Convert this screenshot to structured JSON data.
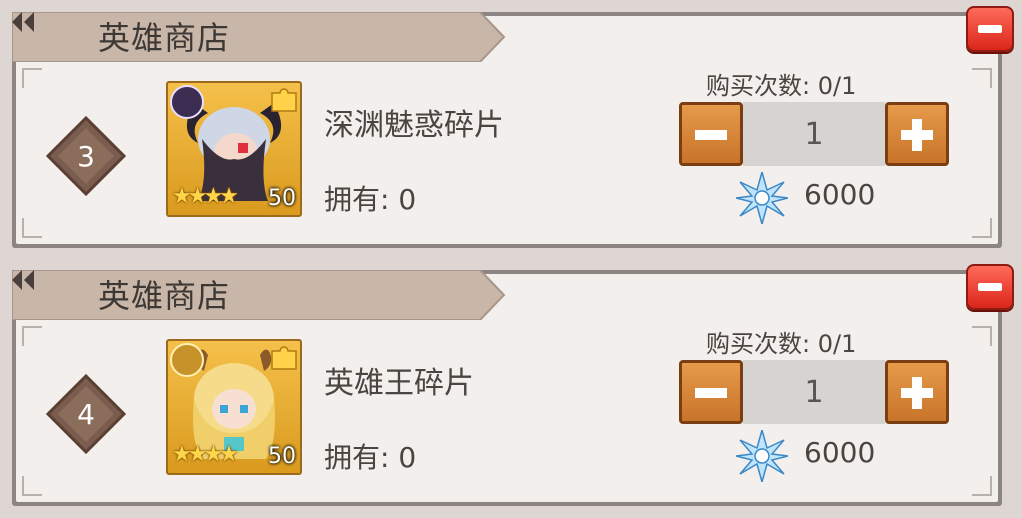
{
  "offers": [
    {
      "header_title": "英雄商店",
      "rank": "3",
      "item_name": "深渊魅惑碎片",
      "owned_label": "拥有: 0",
      "purchase_limit_label": "购买次数: 0/1",
      "quantity": "1",
      "cost": "6000",
      "item_level": "50",
      "stars": "★★★★",
      "portrait_icon": "demon-girl-portrait",
      "badge_icon": "eye-emblem-icon"
    },
    {
      "header_title": "英雄商店",
      "rank": "4",
      "item_name": "英雄王碎片",
      "owned_label": "拥有: 0",
      "purchase_limit_label": "购买次数: 0/1",
      "quantity": "1",
      "cost": "6000",
      "item_level": "50",
      "stars": "★★★★",
      "portrait_icon": "blonde-girl-portrait",
      "badge_icon": "wing-emblem-icon"
    }
  ],
  "colors": {
    "accent_orange": "#d9822f",
    "close_red": "#e0392a",
    "header_bg": "#cbb9ab"
  }
}
